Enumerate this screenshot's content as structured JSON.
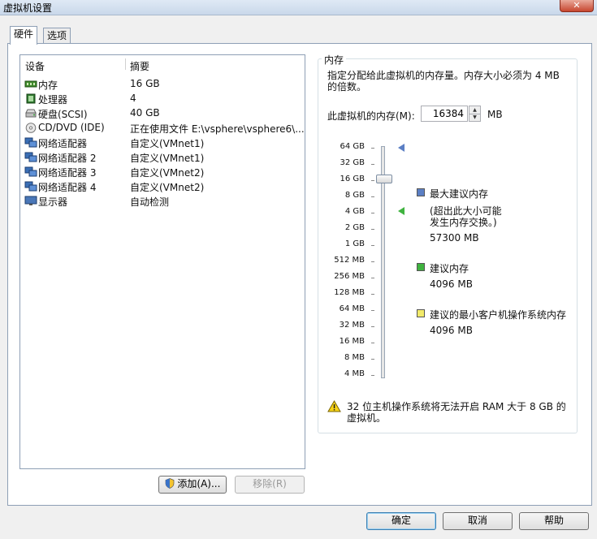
{
  "window": {
    "title": "虚拟机设置",
    "close_glyph": "✕"
  },
  "tabs": [
    {
      "label": "硬件",
      "active": true
    },
    {
      "label": "选项",
      "active": false
    }
  ],
  "device_list": {
    "headers": {
      "device": "设备",
      "summary": "摘要"
    },
    "rows": [
      {
        "icon": "memory-icon",
        "name": "内存",
        "summary": "16 GB"
      },
      {
        "icon": "processor-icon",
        "name": "处理器",
        "summary": "4"
      },
      {
        "icon": "hard-disk-icon",
        "name": "硬盘(SCSI)",
        "summary": "40 GB"
      },
      {
        "icon": "cd-dvd-icon",
        "name": "CD/DVD (IDE)",
        "summary": "正在使用文件 E:\\vsphere\\vsphere6\\..."
      },
      {
        "icon": "network-adapter-icon",
        "name": "网络适配器",
        "summary": "自定义(VMnet1)"
      },
      {
        "icon": "network-adapter-icon",
        "name": "网络适配器 2",
        "summary": "自定义(VMnet1)"
      },
      {
        "icon": "network-adapter-icon",
        "name": "网络适配器 3",
        "summary": "自定义(VMnet2)"
      },
      {
        "icon": "network-adapter-icon",
        "name": "网络适配器 4",
        "summary": "自定义(VMnet2)"
      },
      {
        "icon": "display-icon",
        "name": "显示器",
        "summary": "自动检测"
      }
    ]
  },
  "buttons": {
    "add": "添加(A)...",
    "remove": "移除(R)",
    "ok": "确定",
    "cancel": "取消",
    "help": "帮助"
  },
  "memory": {
    "group_title": "内存",
    "description": "指定分配给此虚拟机的内存量。内存大小必须为 4 MB 的倍数。",
    "field_label": "此虚拟机的内存(M):",
    "value": "16384",
    "unit": "MB",
    "scale_labels": [
      "64 GB",
      "32 GB",
      "16 GB",
      "8 GB",
      "4 GB",
      "2 GB",
      "1 GB",
      "512 MB",
      "256 MB",
      "128 MB",
      "64 MB",
      "32 MB",
      "16 MB",
      "8 MB",
      "4 MB"
    ],
    "legend": {
      "max_title": "最大建议内存",
      "max_note_line1": "(超出此大小可能",
      "max_note_line2": "发生内存交换。)",
      "max_value": "57300 MB",
      "rec_title": "建议内存",
      "rec_value": "4096 MB",
      "min_title": "建议的最小客户机操作系统内存",
      "min_value": "4096 MB"
    },
    "colors": {
      "max": "#5b7fc4",
      "recommended": "#3fb33f",
      "minimum": "#f2ea6a"
    },
    "warning": "32 位主机操作系统将无法开启 RAM 大于 8 GB 的虚拟机。"
  }
}
